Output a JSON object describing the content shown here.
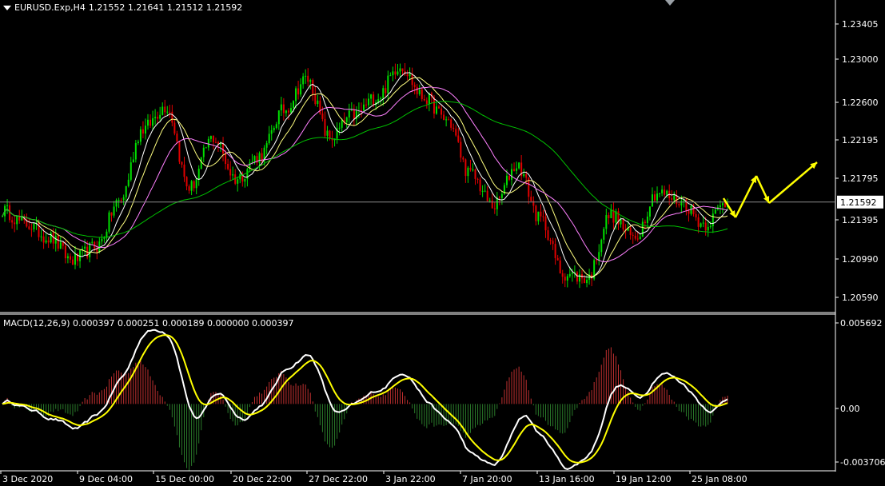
{
  "header": {
    "symbol_tf": "EURUSD.Exp,H4",
    "ohlc": "1.21552 1.21641 1.21512 1.21592"
  },
  "macd": {
    "label": "MACD(12,26,9) 0.000397 0.000251 0.000189 0.000000 0.000397"
  },
  "price_axis": {
    "ticks": [
      "1.23405",
      "1.23000",
      "1.22600",
      "1.22195",
      "1.21795",
      "1.21395",
      "1.20990",
      "1.20590"
    ],
    "current": "1.21592"
  },
  "macd_axis": {
    "ticks": [
      "0.005692",
      "0.00",
      "-0.003706"
    ]
  },
  "time_axis": {
    "ticks": [
      "3 Dec 2020",
      "9 Dec 04:00",
      "15 Dec 00:00",
      "20 Dec 22:00",
      "27 Dec 22:00",
      "3 Jan 22:00",
      "7 Jan 20:00",
      "13 Jan 16:00",
      "19 Jan 12:00",
      "25 Jan 08:00"
    ]
  },
  "colors": {
    "bull": "#00e000",
    "bear": "#e00000",
    "macd_main": "#ffffff",
    "macd_signal": "#ffff00",
    "ma_fast": "#ffff80",
    "ma_mid": "#ff80ff",
    "ma_slow": "#00c000",
    "forecast": "#ffff00"
  },
  "chart_data": {
    "type": "candlestick",
    "price_range": [
      1.204,
      1.2375
    ],
    "key_closes": [
      1.215,
      1.2135,
      1.212,
      1.2095,
      1.211,
      1.216,
      1.224,
      1.2265,
      1.2175,
      1.223,
      1.2185,
      1.221,
      1.226,
      1.2295,
      1.223,
      1.2255,
      1.2275,
      1.231,
      1.2275,
      1.225,
      1.219,
      1.2155,
      1.22,
      1.214,
      1.208,
      1.2075,
      1.2145,
      1.212,
      1.217,
      1.216,
      1.2135,
      1.2159
    ],
    "macd_range": [
      -0.003706,
      0.005692
    ]
  }
}
